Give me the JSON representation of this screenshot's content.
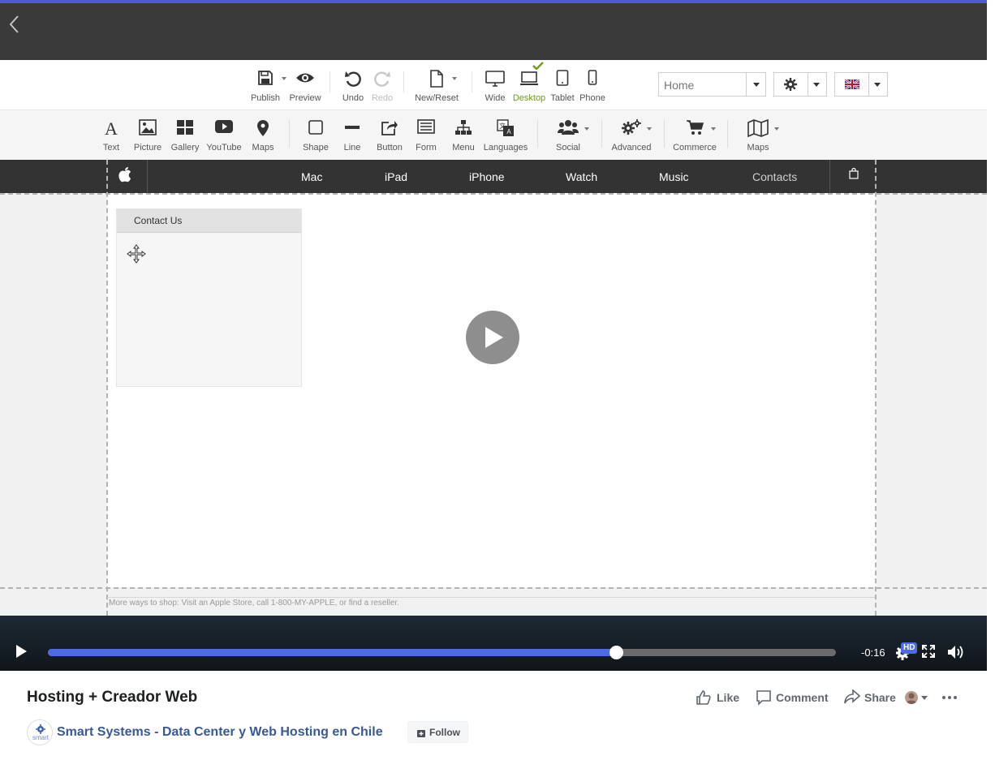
{
  "top_bar": {
    "back_icon": "chevron-left-icon"
  },
  "toolbar_top": {
    "publish": "Publish",
    "preview": "Preview",
    "undo": "Undo",
    "redo": "Redo",
    "new_reset": "New/Reset",
    "wide": "Wide",
    "desktop": "Desktop",
    "tablet": "Tablet",
    "phone": "Phone",
    "page_select_value": "Home"
  },
  "toolbar_elements": {
    "text": "Text",
    "picture": "Picture",
    "gallery": "Gallery",
    "youtube": "YouTube",
    "maps": "Maps",
    "shape": "Shape",
    "line": "Line",
    "button": "Button",
    "form": "Form",
    "menu": "Menu",
    "languages": "Languages",
    "social": "Social",
    "advanced": "Advanced",
    "commerce": "Commerce",
    "maps2": "Maps"
  },
  "site_nav": {
    "items": [
      "Mac",
      "iPad",
      "iPhone",
      "Watch",
      "Music",
      "Contacts"
    ]
  },
  "contact_box": {
    "header": "Contact Us"
  },
  "site_footer": {
    "text": "More ways to shop: Visit an Apple Store, call 1-800-MY-APPLE, or find a reseller."
  },
  "player": {
    "time_remaining": "-0:16",
    "quality_badge": "HD",
    "progress_fraction": 0.721
  },
  "post": {
    "title": "Hosting + Creador Web",
    "like": "Like",
    "comment": "Comment",
    "share": "Share",
    "page_name": "Smart Systems - Data Center y Web Hosting en Chile",
    "avatar_text": "smart",
    "follow": "Follow"
  },
  "colors": {
    "accent": "#4f5bd5",
    "progress": "#4d6ce4",
    "desktop_active": "#6f9a1a",
    "page_link": "#385898"
  }
}
